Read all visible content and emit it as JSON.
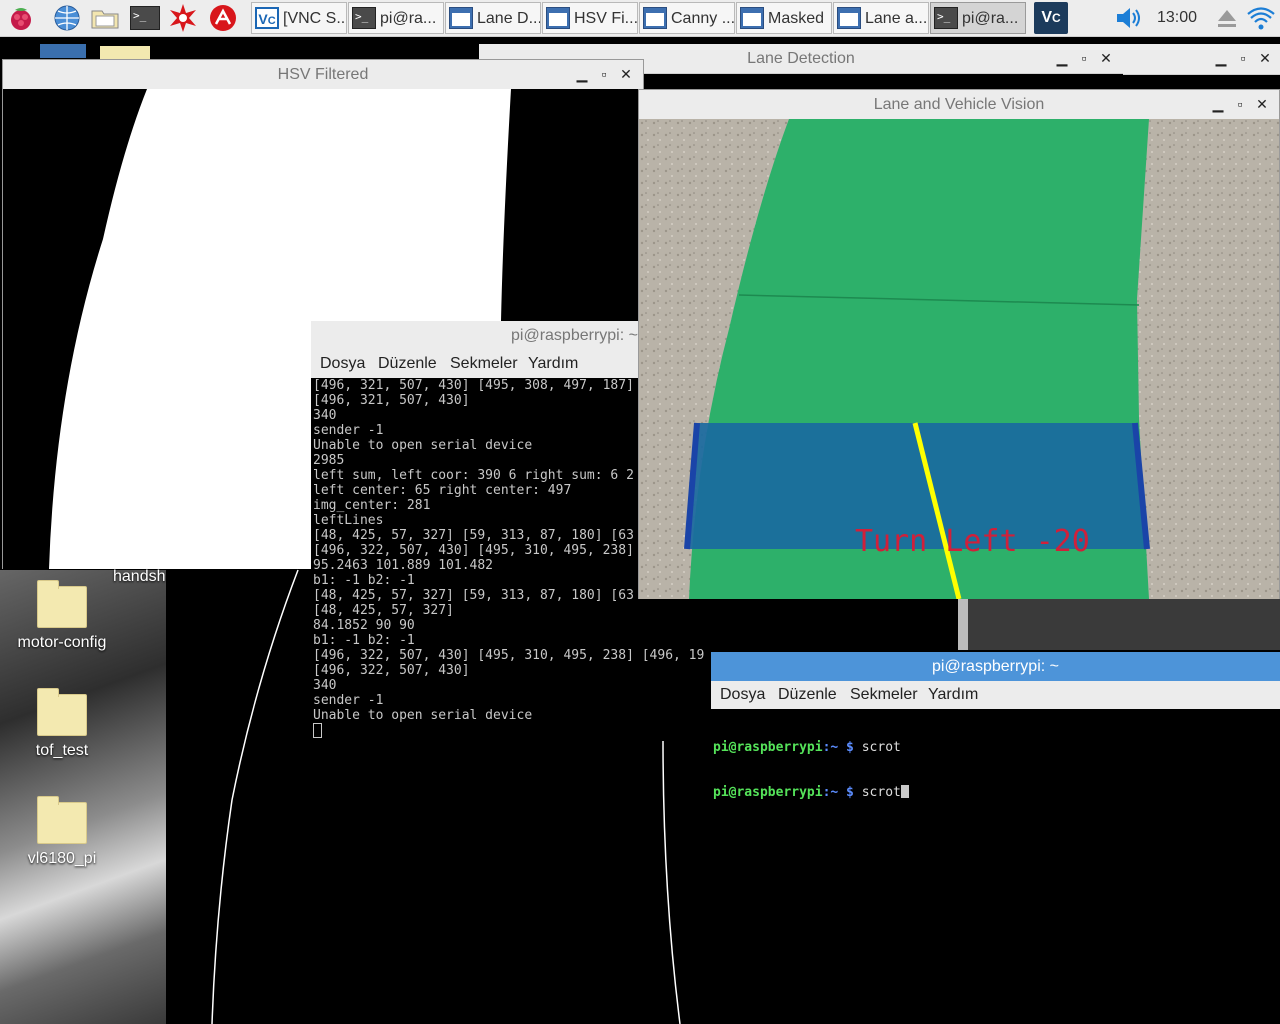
{
  "taskbar": {
    "tasks": [
      {
        "label": "[VNC S...",
        "icon": "vnc-icon"
      },
      {
        "label": "pi@ra...",
        "icon": "terminal-icon"
      },
      {
        "label": "Lane D...",
        "icon": "window-icon"
      },
      {
        "label": "HSV Fi...",
        "icon": "window-icon"
      },
      {
        "label": "Canny ...",
        "icon": "window-icon"
      },
      {
        "label": "Masked",
        "icon": "window-icon"
      },
      {
        "label": "Lane a...",
        "icon": "window-icon"
      },
      {
        "label": "pi@ra...",
        "icon": "terminal-icon"
      }
    ],
    "clock": "13:00"
  },
  "desktop": {
    "items": [
      {
        "label": "handsh"
      },
      {
        "label": "motor-config"
      },
      {
        "label": "tof_test"
      },
      {
        "label": "vl6180_pi"
      }
    ]
  },
  "windows": {
    "lane_detection": {
      "title": "Lane Detection"
    },
    "hsv_filtered": {
      "title": "HSV Filtered"
    },
    "vision": {
      "title": "Lane and Vehicle Vision",
      "overlay_text": "Turn Left -20"
    },
    "terminal1": {
      "title": "pi@raspberrypi: ~/",
      "menu": [
        "Dosya",
        "Düzenle",
        "Sekmeler",
        "Yardım"
      ],
      "lines": [
        "[496, 321, 507, 430] [495, 308, 497, 187]",
        "[496, 321, 507, 430]",
        "340",
        "sender -1",
        "Unable to open serial device",
        "2985",
        "left sum, left coor: 390 6 right sum: 6 2",
        "left center: 65 right center: 497",
        "img_center: 281",
        "leftLines",
        "[48, 425, 57, 327] [59, 313, 87, 180] [63",
        "[496, 322, 507, 430] [495, 310, 495, 238]",
        "95.2463 101.889 101.482",
        "b1: -1 b2: -1",
        "[48, 425, 57, 327] [59, 313, 87, 180] [63",
        "[48, 425, 57, 327]",
        "84.1852 90 90",
        "b1: -1 b2: -1",
        "[496, 322, 507, 430] [495, 310, 495, 238] [496, 19",
        "[496, 322, 507, 430]",
        "340",
        "sender -1",
        "Unable to open serial device"
      ]
    },
    "terminal2": {
      "title": "pi@raspberrypi: ~",
      "menu": [
        "Dosya",
        "Düzenle",
        "Sekmeler",
        "Yardım"
      ],
      "prompt_user": "pi@raspberrypi",
      "prompt_path": ":~ $",
      "commands": [
        "scrot",
        "scrot"
      ]
    }
  },
  "colors": {
    "active_title": "#4d94d9",
    "lane_fill": "#1a6aa0",
    "lane_edge": "#1a44a8",
    "center_line": "#ffff00",
    "overlay_text": "#d0203a",
    "green_lane": "#2db06a"
  }
}
